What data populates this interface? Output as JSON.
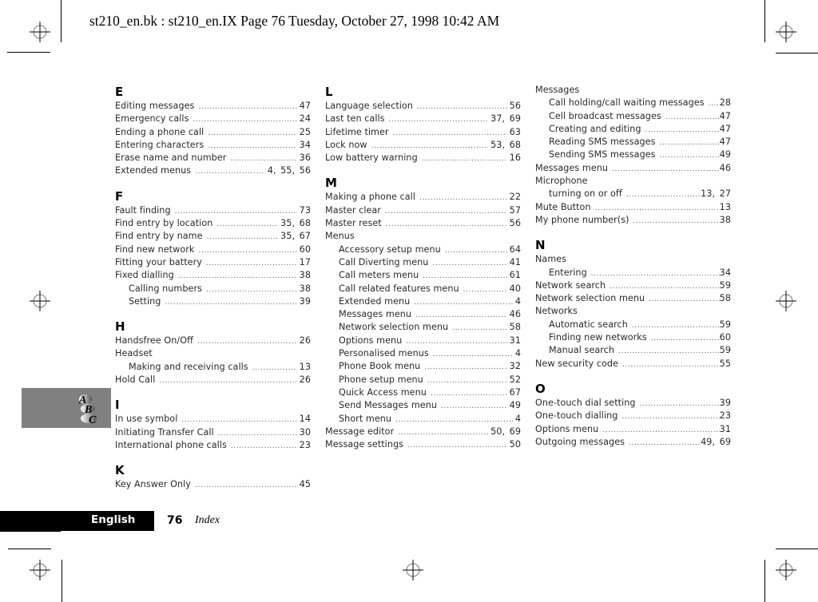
{
  "header": {
    "print_line": "st210_en.bk : st210_en.IX  Page 76  Tuesday, October 27, 1998  10:42 AM"
  },
  "footer": {
    "language_tab": "English",
    "page_number": "76",
    "section_title": "Index"
  },
  "thumb_tab": {
    "icon": "abc-index-icon",
    "letters": [
      "A",
      "B",
      "C"
    ]
  },
  "columns": [
    {
      "sections": [
        {
          "letter": "E",
          "entries": [
            {
              "label": "Editing messages",
              "pages": "47",
              "sub": false
            },
            {
              "label": "Emergency calls",
              "pages": "24",
              "sub": false
            },
            {
              "label": "Ending a phone call",
              "pages": "25",
              "sub": false
            },
            {
              "label": "Entering characters",
              "pages": "34",
              "sub": false
            },
            {
              "label": "Erase name and number",
              "pages": "36",
              "sub": false
            },
            {
              "label": "Extended menus",
              "pages": "4, 55, 56",
              "sub": false
            }
          ]
        },
        {
          "letter": "F",
          "entries": [
            {
              "label": "Fault finding",
              "pages": "73",
              "sub": false
            },
            {
              "label": "Find entry by location",
              "pages": "35, 68",
              "sub": false
            },
            {
              "label": "Find entry by name",
              "pages": "35, 67",
              "sub": false
            },
            {
              "label": "Find new network",
              "pages": "60",
              "sub": false
            },
            {
              "label": "Fitting your battery",
              "pages": "17",
              "sub": false
            },
            {
              "label": "Fixed dialling",
              "pages": "38",
              "sub": false
            },
            {
              "label": "Calling numbers",
              "pages": "38",
              "sub": true
            },
            {
              "label": "Setting",
              "pages": "39",
              "sub": true
            }
          ]
        },
        {
          "letter": "H",
          "entries": [
            {
              "label": "Handsfree On/Off",
              "pages": "26",
              "sub": false
            },
            {
              "label": "Headset",
              "pages": "",
              "sub": false
            },
            {
              "label": "Making and receiving calls",
              "pages": "13",
              "sub": true
            },
            {
              "label": "Hold Call",
              "pages": "26",
              "sub": false
            }
          ]
        },
        {
          "letter": "I",
          "entries": [
            {
              "label": "In use symbol",
              "pages": "14",
              "sub": false
            },
            {
              "label": "Initiating Transfer Call",
              "pages": "30",
              "sub": false
            },
            {
              "label": "International phone calls",
              "pages": "23",
              "sub": false
            }
          ]
        },
        {
          "letter": "K",
          "entries": [
            {
              "label": "Key Answer Only",
              "pages": "45",
              "sub": false
            }
          ]
        }
      ]
    },
    {
      "sections": [
        {
          "letter": "L",
          "entries": [
            {
              "label": "Language selection",
              "pages": "56",
              "sub": false
            },
            {
              "label": "Last ten calls",
              "pages": "37, 69",
              "sub": false
            },
            {
              "label": "Lifetime timer",
              "pages": "63",
              "sub": false
            },
            {
              "label": "Lock now",
              "pages": "53, 68",
              "sub": false
            },
            {
              "label": "Low battery warning",
              "pages": "16",
              "sub": false
            }
          ]
        },
        {
          "letter": "M",
          "entries": [
            {
              "label": "Making a phone call",
              "pages": "22",
              "sub": false
            },
            {
              "label": "Master clear",
              "pages": "57",
              "sub": false
            },
            {
              "label": "Master reset",
              "pages": "56",
              "sub": false
            },
            {
              "label": "Menus",
              "pages": "",
              "sub": false
            },
            {
              "label": "Accessory setup menu",
              "pages": "64",
              "sub": true
            },
            {
              "label": "Call Diverting menu",
              "pages": "41",
              "sub": true
            },
            {
              "label": "Call meters menu",
              "pages": "61",
              "sub": true
            },
            {
              "label": "Call related features menu",
              "pages": "40",
              "sub": true
            },
            {
              "label": "Extended menu",
              "pages": "4",
              "sub": true
            },
            {
              "label": "Messages menu",
              "pages": "46",
              "sub": true
            },
            {
              "label": "Network selection menu",
              "pages": "58",
              "sub": true
            },
            {
              "label": "Options menu",
              "pages": "31",
              "sub": true
            },
            {
              "label": "Personalised menus",
              "pages": "4",
              "sub": true
            },
            {
              "label": "Phone Book menu",
              "pages": "32",
              "sub": true
            },
            {
              "label": "Phone setup menu",
              "pages": "52",
              "sub": true
            },
            {
              "label": "Quick Access menu",
              "pages": "67",
              "sub": true
            },
            {
              "label": "Send Messages menu",
              "pages": "49",
              "sub": true
            },
            {
              "label": "Short menu",
              "pages": "4",
              "sub": true
            },
            {
              "label": "Message editor",
              "pages": "50, 69",
              "sub": false
            },
            {
              "label": "Message settings",
              "pages": "50",
              "sub": false
            }
          ]
        }
      ]
    },
    {
      "sections": [
        {
          "letter": "",
          "entries": [
            {
              "label": "Messages",
              "pages": "",
              "sub": false
            },
            {
              "label": "Call holding/call waiting messages",
              "pages": "28",
              "sub": true
            },
            {
              "label": "Cell broadcast messages",
              "pages": "47",
              "sub": true
            },
            {
              "label": "Creating and editing",
              "pages": "47",
              "sub": true
            },
            {
              "label": "Reading SMS messages",
              "pages": "47",
              "sub": true
            },
            {
              "label": "Sending SMS messages",
              "pages": "49",
              "sub": true
            },
            {
              "label": "Messages menu",
              "pages": "46",
              "sub": false
            },
            {
              "label": "Microphone",
              "pages": "",
              "sub": false
            },
            {
              "label": "turning on or off",
              "pages": "13, 27",
              "sub": true
            },
            {
              "label": "Mute Button",
              "pages": "13",
              "sub": false
            },
            {
              "label": "My phone number(s)",
              "pages": "38",
              "sub": false
            }
          ]
        },
        {
          "letter": "N",
          "entries": [
            {
              "label": "Names",
              "pages": "",
              "sub": false
            },
            {
              "label": "Entering",
              "pages": "34",
              "sub": true
            },
            {
              "label": "Network search",
              "pages": "59",
              "sub": false
            },
            {
              "label": "Network selection menu",
              "pages": "58",
              "sub": false
            },
            {
              "label": "Networks",
              "pages": "",
              "sub": false
            },
            {
              "label": "Automatic search",
              "pages": "59",
              "sub": true
            },
            {
              "label": "Finding new networks",
              "pages": "60",
              "sub": true
            },
            {
              "label": "Manual search",
              "pages": "59",
              "sub": true
            },
            {
              "label": "New security code",
              "pages": "55",
              "sub": false
            }
          ]
        },
        {
          "letter": "O",
          "entries": [
            {
              "label": "One-touch dial setting",
              "pages": "39",
              "sub": false
            },
            {
              "label": "One-touch dialling",
              "pages": "23",
              "sub": false
            },
            {
              "label": "Options menu",
              "pages": "31",
              "sub": false
            },
            {
              "label": "Outgoing messages",
              "pages": "49, 69",
              "sub": false
            }
          ]
        }
      ]
    }
  ]
}
